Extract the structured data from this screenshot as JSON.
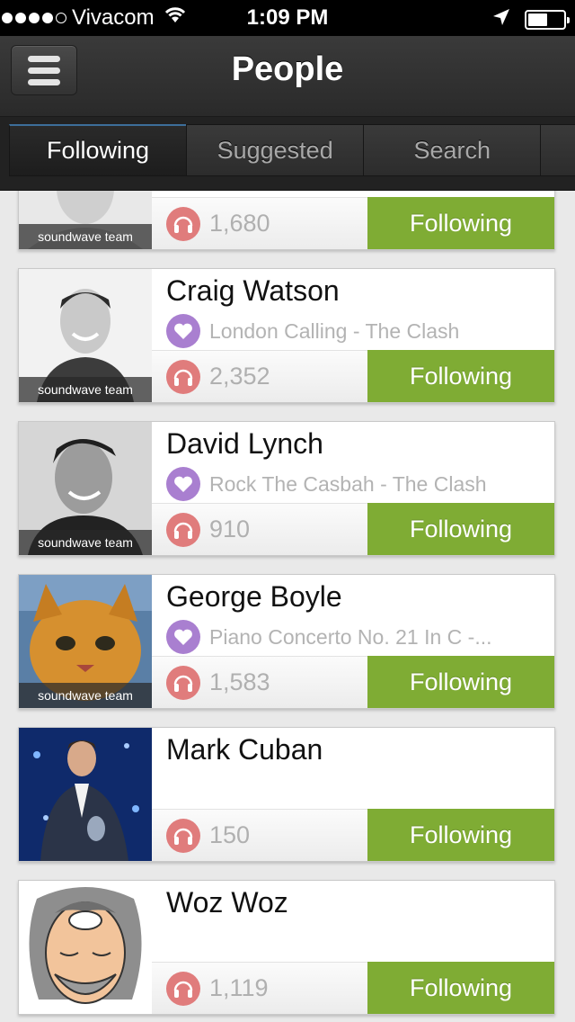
{
  "status_bar": {
    "carrier": "Vivacom",
    "time": "1:09 PM",
    "battery_level": 0.55,
    "signal_bars_filled": 4,
    "signal_bars_total": 5,
    "icons": [
      "wifi-icon",
      "location-arrow-icon",
      "battery-icon"
    ]
  },
  "nav": {
    "title": "People",
    "menu_icon": "hamburger-menu-icon"
  },
  "tabs": [
    {
      "label": "Following",
      "active": true
    },
    {
      "label": "Suggested",
      "active": false
    },
    {
      "label": "Search",
      "active": false
    }
  ],
  "colors": {
    "follow_green": "#7fac34",
    "heart_purple": "#a97fd0",
    "headphones_red": "#e07c7c",
    "active_tab_accent": "#3d6e9a"
  },
  "people": [
    {
      "name": "",
      "song": "",
      "listens": "1,680",
      "badge": "soundwave team",
      "button": "Following"
    },
    {
      "name": "Craig Watson",
      "song": "London Calling - The Clash",
      "listens": "2,352",
      "badge": "soundwave team",
      "button": "Following"
    },
    {
      "name": "David Lynch",
      "song": "Rock The Casbah - The Clash",
      "listens": "910",
      "badge": "soundwave team",
      "button": "Following"
    },
    {
      "name": "George Boyle",
      "song": "Piano Concerto No. 21 In C -...",
      "listens": "1,583",
      "badge": "soundwave team",
      "button": "Following"
    },
    {
      "name": "Mark Cuban",
      "song": "",
      "listens": "150",
      "badge": "",
      "button": "Following"
    },
    {
      "name": "Woz Woz",
      "song": "",
      "listens": "1,119",
      "badge": "",
      "button": "Following"
    }
  ]
}
